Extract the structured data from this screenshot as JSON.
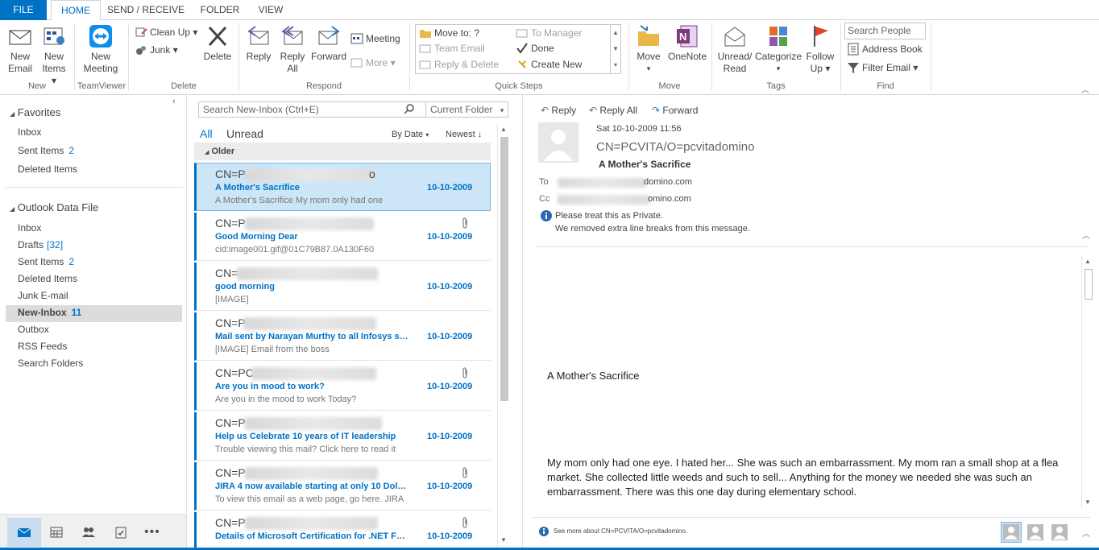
{
  "tabs": [
    "FILE",
    "HOME",
    "SEND / RECEIVE",
    "FOLDER",
    "VIEW"
  ],
  "ribbon": {
    "new_email": "New Email",
    "new_email_l1": "New",
    "new_email_l2": "Email",
    "new_items_l1": "New",
    "new_items_l2": "Items",
    "new_group": "New",
    "new_meeting_l1": "New",
    "new_meeting_l2": "Meeting",
    "teamviewer_group": "TeamViewer",
    "clean_up": "Clean Up",
    "junk": "Junk",
    "delete": "Delete",
    "delete_group": "Delete",
    "reply": "Reply",
    "reply_all_l1": "Reply",
    "reply_all_l2": "All",
    "forward": "Forward",
    "meeting": "Meeting",
    "more": "More",
    "respond_group": "Respond",
    "quick_steps": {
      "move_to": "Move to: ?",
      "team_email": "Team Email",
      "reply_delete": "Reply & Delete",
      "to_manager": "To Manager",
      "done": "Done",
      "create_new": "Create New",
      "group": "Quick Steps"
    },
    "move": "Move",
    "onenote": "OneNote",
    "move_group": "Move",
    "unread_read_l1": "Unread/",
    "unread_read_l2": "Read",
    "categorize": "Categorize",
    "follow_up_l1": "Follow",
    "follow_up_l2": "Up",
    "tags_group": "Tags",
    "search_people": "Search People",
    "address_book": "Address Book",
    "filter_email": "Filter Email",
    "find_group": "Find"
  },
  "nav": {
    "favorites": "Favorites",
    "fav_items": [
      {
        "label": "Inbox",
        "count": ""
      },
      {
        "label": "Sent Items",
        "count": "2"
      },
      {
        "label": "Deleted Items",
        "count": ""
      }
    ],
    "data_file": "Outlook Data File",
    "items": [
      {
        "label": "Inbox",
        "count": ""
      },
      {
        "label": "Drafts",
        "count": "[32]"
      },
      {
        "label": "Sent Items",
        "count": "2"
      },
      {
        "label": "Deleted Items",
        "count": ""
      },
      {
        "label": "Junk E-mail",
        "count": ""
      },
      {
        "label": "New-Inbox",
        "count": "11"
      },
      {
        "label": "Outbox",
        "count": ""
      },
      {
        "label": "RSS Feeds",
        "count": ""
      },
      {
        "label": "Search Folders",
        "count": ""
      }
    ]
  },
  "list": {
    "search_placeholder": "Search New-Inbox (Ctrl+E)",
    "scope": "Current Folder",
    "filter_all": "All",
    "filter_unread": "Unread",
    "sort_by": "By Date",
    "sort_order": "Newest",
    "group_header": "Older",
    "messages": [
      {
        "from": "CN=P",
        "from_tail": "o",
        "subject": "A Mother's Sacrifice",
        "preview": "A Mother's Sacrifice    My mom only had one",
        "date": "10-10-2009"
      },
      {
        "from": "CN=P",
        "from_tail": "",
        "subject": "Good Morning Dear",
        "preview": "cid:image001.gif@01C79B87.0A130F60",
        "date": "10-10-2009"
      },
      {
        "from": "CN=",
        "from_tail": "",
        "subject": "good morning",
        "preview": "[IMAGE]",
        "date": "10-10-2009"
      },
      {
        "from": "CN=P",
        "from_tail": "",
        "subject": "Mail sent by Narayan Murthy to all Infosys st...",
        "preview": "[IMAGE]  Email from the boss",
        "date": "10-10-2009"
      },
      {
        "from": "CN=PC",
        "from_tail": "",
        "subject": "Are you in mood to work?",
        "preview": "Are you in the mood to work Today?",
        "date": "10-10-2009"
      },
      {
        "from": "CN=P",
        "from_tail": "",
        "subject": "Help us Celebrate 10 years of IT leadership",
        "preview": "Trouble viewing this mail? Click here to read it",
        "date": "10-10-2009"
      },
      {
        "from": "CN=P",
        "from_tail": "",
        "subject": "JIRA 4 now available starting at only 10 Dollars",
        "preview": "To view this email as a web page, go here.  JIRA",
        "date": "10-10-2009"
      },
      {
        "from": "CN=P",
        "from_tail": "",
        "subject": "Details of Microsoft Certification for .NET Fra...",
        "preview": "",
        "date": "10-10-2009"
      }
    ]
  },
  "reading": {
    "reply": "Reply",
    "reply_all": "Reply All",
    "forward": "Forward",
    "date": "Sat 10-10-2009 11:56",
    "sender": "CN=PCVITA/O=pcvitadomino",
    "subject": "A Mother's Sacrifice",
    "to_label": "To",
    "to_tail": "domino.com",
    "cc_label": "Cc",
    "cc_tail": "omino.com",
    "info_line1": "Please treat this as Private.",
    "info_line2": "We removed extra line breaks from this message.",
    "body_title": "A Mother's Sacrifice",
    "body_para": "My mom only had one eye. I hated her... She was such an embarrassment. My mom ran a small shop at a flea market. She collected little weeds and such to sell... Anything for the money we needed she was such an embarrassment. There was this one day during elementary school.",
    "see_more": "See more about CN=PCVITA/O=pcvitadomino."
  },
  "colors": {
    "accent": "#0072c6",
    "selected": "#cde6f7"
  }
}
